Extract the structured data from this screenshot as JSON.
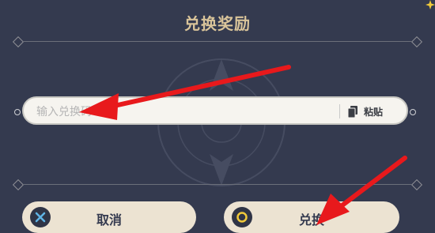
{
  "dialog": {
    "title": "兑换奖励"
  },
  "code_input": {
    "placeholder": "输入兑换码",
    "value": ""
  },
  "paste_button": {
    "label": "粘贴",
    "icon": "clipboard-icon"
  },
  "buttons": {
    "cancel": {
      "label": "取消",
      "icon": "close-icon"
    },
    "confirm": {
      "label": "兑换",
      "icon": "circle-icon"
    }
  },
  "colors": {
    "background": "#343a4f",
    "title": "#d9c49a",
    "button": "#ece3d2",
    "arrow": "#e8191c",
    "confirm_ring": "#f0c93a"
  }
}
